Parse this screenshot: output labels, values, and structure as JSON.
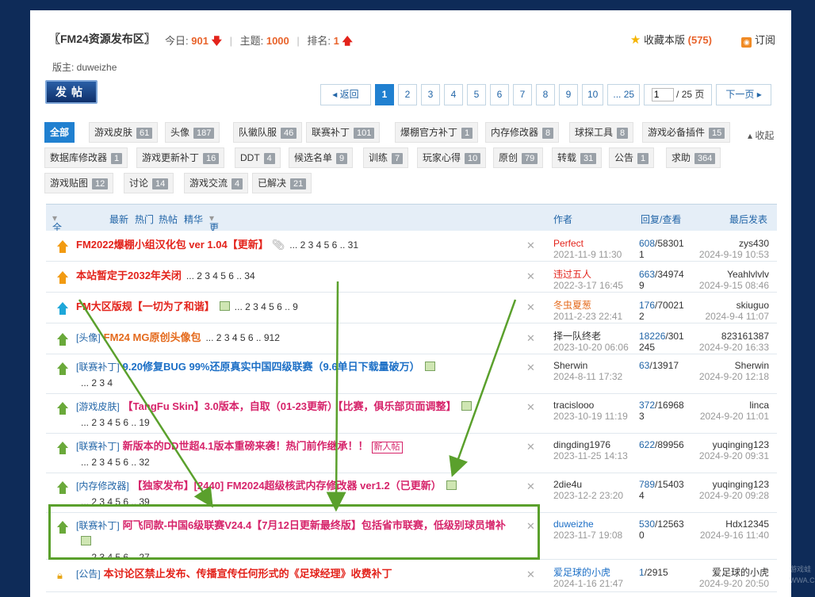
{
  "header": {
    "forum_title": "〖FM24资源发布区〗",
    "today_label": "今日:",
    "today_count": "901",
    "topics_label": "主题:",
    "topics_count": "1000",
    "rank_label": "排名:",
    "rank_value": "1",
    "fav_label": "收藏本版",
    "fav_count": "(575)",
    "subscribe_label": "订阅",
    "moderator": "版主: duweizhe"
  },
  "toolbar": {
    "post_label": "发帖",
    "back_label": "返回",
    "pages": [
      "1",
      "2",
      "3",
      "4",
      "5",
      "6",
      "7",
      "8",
      "9",
      "10",
      "... 25"
    ],
    "page_input": "1",
    "page_total": "/ 25 页",
    "next_label": "下一页"
  },
  "tags": [
    {
      "label": "全部",
      "count": ""
    },
    {
      "label": "游戏皮肤",
      "count": "61"
    },
    {
      "label": "头像",
      "count": "187"
    },
    {
      "label": "队徽队服",
      "count": "46"
    },
    {
      "label": "联赛补丁",
      "count": "101"
    },
    {
      "label": "爆棚官方补丁",
      "count": "1"
    },
    {
      "label": "内存修改器",
      "count": "8"
    },
    {
      "label": "球探工具",
      "count": "8"
    },
    {
      "label": "游戏必备插件",
      "count": "15"
    },
    {
      "label": "数据库修改器",
      "count": "1"
    },
    {
      "label": "游戏更新补丁",
      "count": "16"
    },
    {
      "label": "DDT",
      "count": "4"
    },
    {
      "label": "候选名单",
      "count": "9"
    },
    {
      "label": "训练",
      "count": "7"
    },
    {
      "label": "玩家心得",
      "count": "10"
    },
    {
      "label": "原创",
      "count": "79"
    },
    {
      "label": "转载",
      "count": "31"
    },
    {
      "label": "公告",
      "count": "1"
    },
    {
      "label": "求助",
      "count": "364"
    },
    {
      "label": "游戏贴图",
      "count": "12"
    },
    {
      "label": "讨论",
      "count": "14"
    },
    {
      "label": "游戏交流",
      "count": "4"
    },
    {
      "label": "已解决",
      "count": "21"
    }
  ],
  "collapse_label": "收起",
  "table_header": {
    "all_topics": "全部主题",
    "filters": [
      "最新",
      "热门",
      "热帖",
      "精华",
      "更多"
    ],
    "author": "作者",
    "replies": "回复/查看",
    "last_post": "最后发表"
  },
  "rows": [
    {
      "cat": "",
      "title": "FM2022爆棚小组汉化包 ver 1.04【更新】",
      "pages": "... 2 3 4 5 6 .. 31",
      "author": "Perfect",
      "adate": "2021-11-9 11:30",
      "replies": "608",
      "views": "/58301",
      "views2": "1",
      "last": "zys430",
      "ldate": "2024-9-19 10:53"
    },
    {
      "cat": "",
      "title": "本站暂定于2032年关闭",
      "pages": "... 2 3 4 5 6 .. 34",
      "author": "违过五人",
      "adate": "2022-3-17 16:45",
      "replies": "663",
      "views": "/34974",
      "views2": "9",
      "last": "Yeahlvlvlv",
      "ldate": "2024-9-15 08:46"
    },
    {
      "cat": "",
      "title": "FM大区版规【一切为了和谐】",
      "pages": "... 2 3 4 5 6 .. 9",
      "author": "冬虫夏葱",
      "adate": "2011-2-23 22:41",
      "replies": "176",
      "views": "/70021",
      "views2": "2",
      "last": "skiuguo",
      "ldate": "2024-9-4 11:07"
    },
    {
      "cat": "[头像]",
      "title": "FM24 MG原创头像包",
      "pages": "... 2 3 4 5 6 .. 912",
      "author": "择一队终老",
      "adate": "2023-10-20 06:06",
      "replies": "18226",
      "views": "/301",
      "views2": "245",
      "last": "823161387",
      "ldate": "2024-9-20 16:33"
    },
    {
      "cat": "[联赛补丁]",
      "title": "9.20修复BUG 99%还原真实中国四级联赛（9.6单日下载量破万）",
      "pages": "... 2 3 4",
      "author": "Sherwin",
      "adate": "2024-8-11 17:32",
      "replies": "63",
      "views": "/13917",
      "views2": "",
      "last": "Sherwin",
      "ldate": "2024-9-20 12:18"
    },
    {
      "cat": "[游戏皮肤]",
      "title": "【TangFu Skin】3.0版本，自取（01-23更新）【比赛，俱乐部页面调整】",
      "pages": "... 2 3 4 5 6 .. 19",
      "author": "tracislooo",
      "adate": "2023-10-19 11:19",
      "replies": "372",
      "views": "/16968",
      "views2": "3",
      "last": "linca",
      "ldate": "2024-9-20 11:01"
    },
    {
      "cat": "[联赛补丁]",
      "title": "新版本的DD世超4.1版本重磅来袭！热门前作继承！！",
      "pages": "... 2 3 4 5 6 .. 32",
      "new": "新人帖",
      "author": "dingding1976",
      "adate": "2023-11-25 14:13",
      "replies": "622",
      "views": "/89956",
      "views2": "",
      "last": "yuqinging123",
      "ldate": "2024-9-20 09:31"
    },
    {
      "cat": "[内存修改器]",
      "title": "【独家发布】[2440] FM2024超级核武内存修改器 ver1.2（已更新）",
      "pages": "... 2 3 4 5 6 .. 39",
      "author": "2die4u",
      "adate": "2023-12-2 23:20",
      "replies": "789",
      "views": "/15403",
      "views2": "4",
      "last": "yuqinging123",
      "ldate": "2024-9-20 09:28"
    },
    {
      "cat": "[联赛补丁]",
      "title": "阿飞同款-中国6级联赛V24.4【7月12日更新最终版】包括省市联赛，低级别球员增补",
      "pages": "... 2 3 4 5 6 .. 27",
      "author": "duweizhe",
      "adate": "2023-11-7 19:08",
      "replies": "530",
      "views": "/12563",
      "views2": "0",
      "last": "Hdx12345",
      "ldate": "2024-9-16 11:40"
    },
    {
      "cat": "[公告]",
      "title": "本讨论区禁止发布、传播宣传任何形式的《足球经理》收费补丁",
      "pages": "",
      "author": "爱足球的小虎",
      "adate": "2024-1-16 21:47",
      "replies": "1",
      "views": "/2915",
      "views2": "",
      "last": "爱足球的小虎",
      "ldate": "2024-9-20 20:50"
    }
  ],
  "watermark": "游戏蛙 WWA.CC"
}
